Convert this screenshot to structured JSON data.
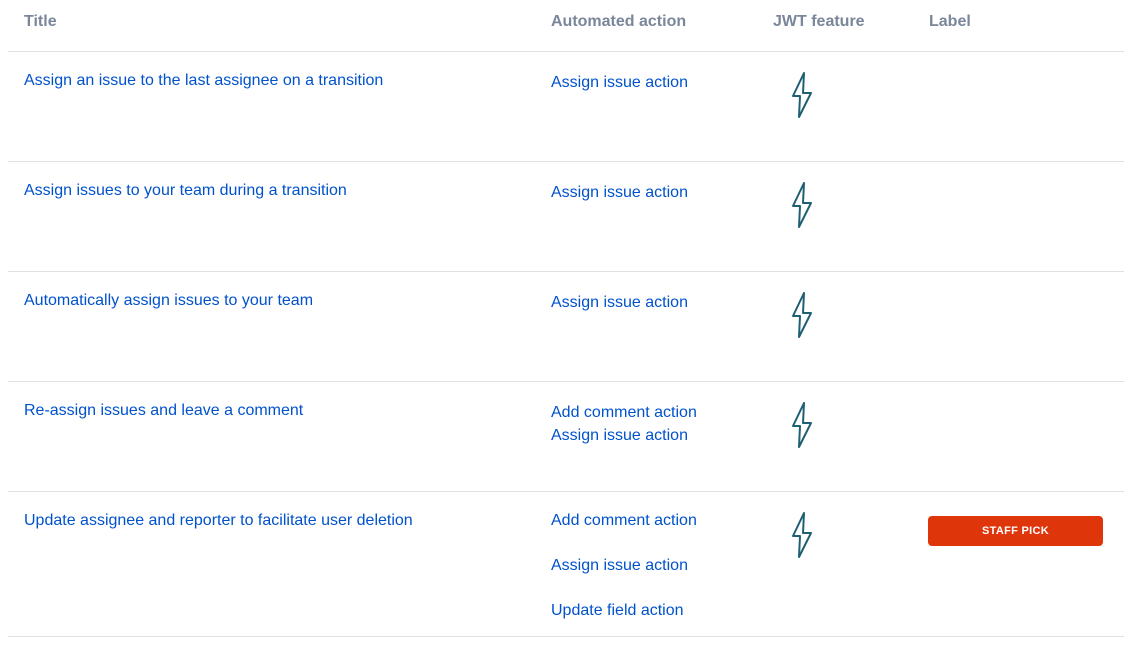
{
  "headers": {
    "title": "Title",
    "automated_action": "Automated action",
    "jwt_feature": "JWT feature",
    "label": "Label"
  },
  "rows": [
    {
      "title": "Assign an issue to the last assignee on a transition",
      "actions": [
        "Assign issue action"
      ],
      "jwt_feature_icon": "lightning-bolt-icon",
      "label": ""
    },
    {
      "title": "Assign issues to your team during a transition",
      "actions": [
        "Assign issue action"
      ],
      "jwt_feature_icon": "lightning-bolt-icon",
      "label": ""
    },
    {
      "title": "Automatically assign issues to your team",
      "actions": [
        "Assign issue action"
      ],
      "jwt_feature_icon": "lightning-bolt-icon",
      "label": ""
    },
    {
      "title": "Re-assign issues and leave a comment",
      "actions": [
        "Add comment action",
        "Assign issue action"
      ],
      "jwt_feature_icon": "lightning-bolt-icon",
      "label": ""
    },
    {
      "title": "Update assignee and reporter to facilitate user deletion",
      "actions": [
        "Add comment action",
        "Assign issue action",
        "Update field action"
      ],
      "jwt_feature_icon": "lightning-bolt-icon",
      "label": "STAFF PICK"
    }
  ],
  "colors": {
    "link": "#0052cc",
    "header_text": "#7a869a",
    "divider": "#dfe1e6",
    "bolt": "#1f5f73",
    "staff_pick_badge": "#de350b"
  }
}
